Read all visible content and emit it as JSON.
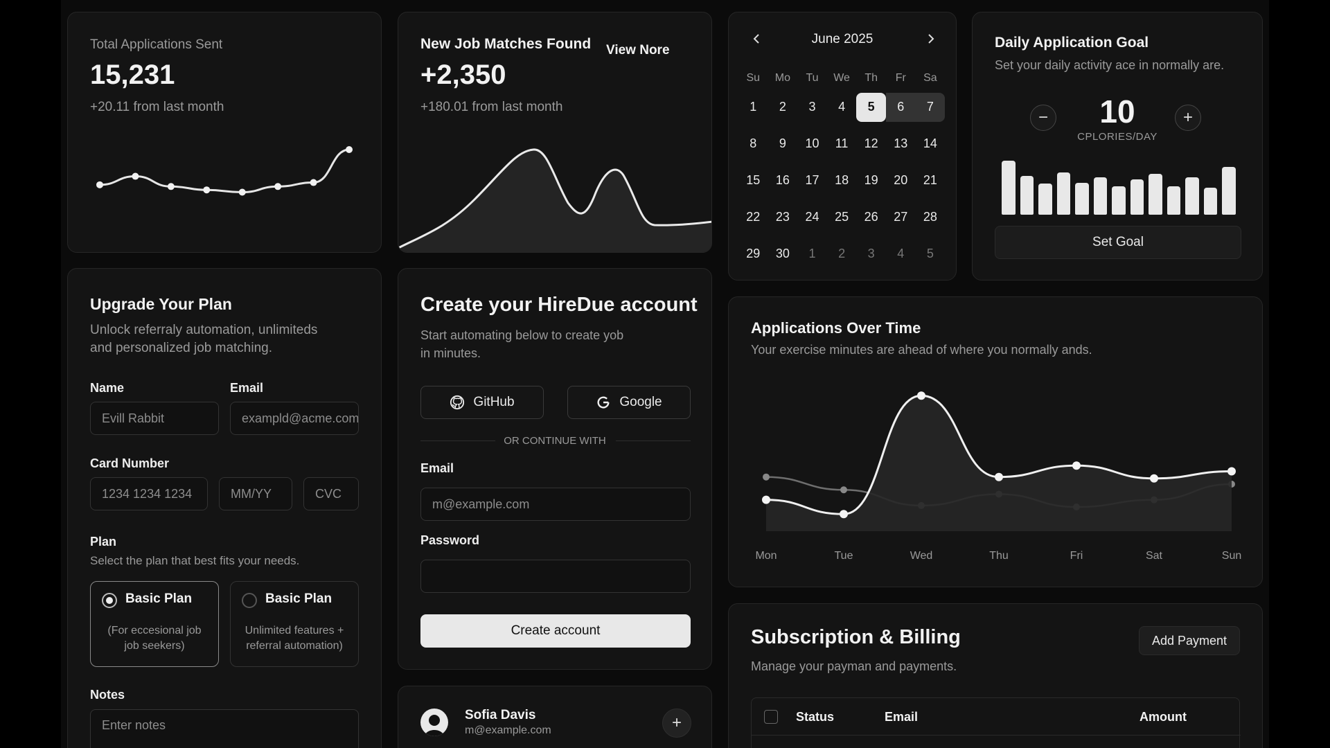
{
  "total_apps": {
    "title": "Total Applications Sent",
    "value": "15,231",
    "delta": "+20.11 from last month",
    "trend": [
      0.38,
      0.53,
      0.35,
      0.29,
      0.25,
      0.35,
      0.42,
      1.0
    ]
  },
  "job_matches": {
    "title": "New Job Matches Found",
    "link": "View Nore",
    "value": "+2,350",
    "delta": "+180.01 from last month"
  },
  "calendar": {
    "month": "June 2025",
    "weekdays": [
      "Su",
      "Mo",
      "Tu",
      "We",
      "Th",
      "Fr",
      "Sa"
    ],
    "weeks": [
      [
        "1",
        "2",
        "3",
        "4",
        "5",
        "6",
        "7"
      ],
      [
        "8",
        "9",
        "10",
        "11",
        "12",
        "13",
        "14"
      ],
      [
        "15",
        "16",
        "17",
        "18",
        "19",
        "20",
        "21"
      ],
      [
        "22",
        "23",
        "24",
        "25",
        "26",
        "27",
        "28"
      ],
      [
        "29",
        "30",
        "1",
        "2",
        "3",
        "4",
        "5"
      ]
    ],
    "selected": "5",
    "range_end": "7"
  },
  "goal": {
    "title": "Daily Application Goal",
    "subtitle": "Set your daily activity ace in normally are.",
    "value": "10",
    "unit": "CPLORIES/DAY",
    "minus": "−",
    "plus": "+",
    "bars": [
      0.95,
      0.68,
      0.55,
      0.74,
      0.56,
      0.66,
      0.5,
      0.62,
      0.72,
      0.5,
      0.66,
      0.48,
      0.84
    ],
    "button": "Set Goal"
  },
  "upgrade": {
    "title": "Upgrade Your Plan",
    "subtitle_1": "Unlock referraly automation, unlimiteds",
    "subtitle_2": "and personalized job matching.",
    "name_label": "Name",
    "name_value": "Evill Rabbit",
    "email_label": "Email",
    "email_value": "exampld@acme.com",
    "card_label": "Card Number",
    "card_value": "1234 1234 1234",
    "exp_value": "MM/YY",
    "cvc_value": "CVC",
    "plan_label": "Plan",
    "plan_desc": "Select the plan that best fits your needs.",
    "plans": [
      {
        "title": "Basic Plan",
        "desc_1": "(For eccesional job",
        "desc_2": "job seekers)"
      },
      {
        "title": "Basic Plan",
        "desc_1": "Unlimited features +",
        "desc_2": "referral automation)"
      }
    ],
    "notes_label": "Notes",
    "notes_placeholder": "Enter notes"
  },
  "account": {
    "title": "Create your HireDue account",
    "subtitle_1": "Start automating below to create yob",
    "subtitle_2": "in minutes.",
    "github": "GitHub",
    "google": "Google",
    "divider": "OR CONTINUE WITH",
    "email_label": "Email",
    "email_placeholder": "m@example.com",
    "password_label": "Password",
    "submit": "Create account"
  },
  "profile": {
    "name": "Sofia Davis",
    "email": "m@example.com",
    "add": "+"
  },
  "apps_over_time": {
    "title": "Applications Over Time",
    "subtitle": "Your exercise minutes are ahead of where you normally ands."
  },
  "chart_data": {
    "type": "line",
    "title": "Applications Over Time",
    "categories": [
      "Mon",
      "Tue",
      "Wed",
      "Thu",
      "Fri",
      "Sat",
      "Sun"
    ],
    "series": [
      {
        "values": [
          0.22,
          0.12,
          0.95,
          0.38,
          0.46,
          0.37,
          0.42
        ]
      },
      {
        "values": [
          0.38,
          0.29,
          0.18,
          0.26,
          0.17,
          0.22,
          0.33
        ]
      }
    ],
    "ylim": [
      0,
      1
    ],
    "grid": false
  },
  "billing": {
    "title": "Subscription & Billing",
    "subtitle": "Manage your payman and payments.",
    "add_button": "Add Payment",
    "columns": [
      "Status",
      "Email",
      "Amount"
    ]
  },
  "icons": {
    "cal_prev": "chevron-left-icon",
    "cal_next": "chevron-right-icon",
    "github": "github-icon",
    "google": "google-icon",
    "avatar": "avatar"
  }
}
